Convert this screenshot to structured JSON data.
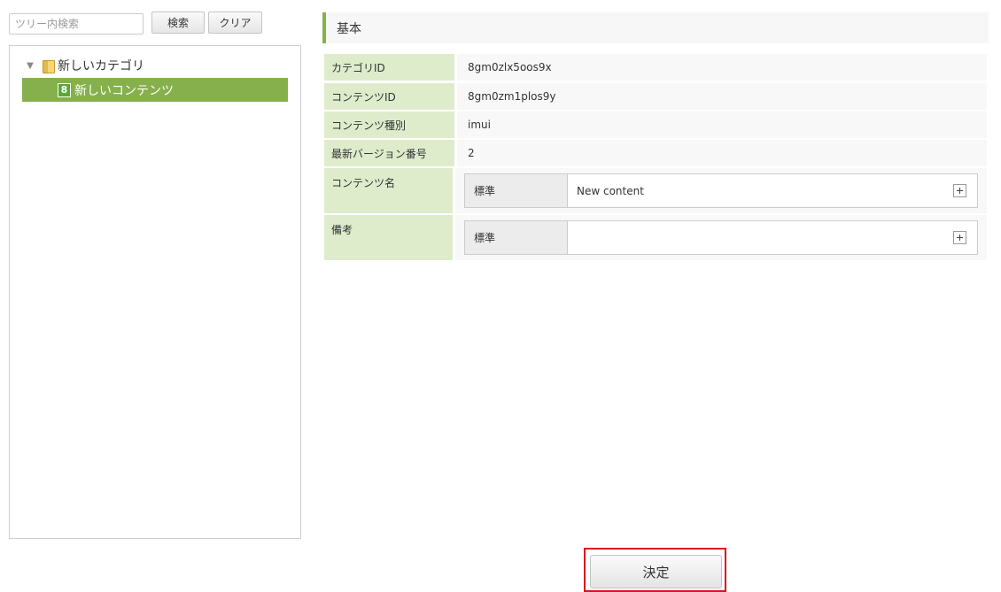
{
  "tree_search": {
    "placeholder": "ツリー内検索",
    "search_label": "検索",
    "clear_label": "クリア"
  },
  "tree": {
    "root": {
      "label": "新しいカテゴリ",
      "icon": "folder-icon"
    },
    "child": {
      "label": "新しいコンテンツ",
      "icon_glyph": "8"
    }
  },
  "section": {
    "title": "基本"
  },
  "details": {
    "category_id": {
      "label": "カテゴリID",
      "value": "8gm0zlx5oos9x"
    },
    "content_id": {
      "label": "コンテンツID",
      "value": "8gm0zm1plos9y"
    },
    "content_type": {
      "label": "コンテンツ種別",
      "value": "imui"
    },
    "version": {
      "label": "最新バージョン番号",
      "value": "2"
    },
    "content_name": {
      "label": "コンテンツ名",
      "locale": "標準",
      "value": "New content"
    },
    "remarks": {
      "label": "備考",
      "locale": "標準",
      "value": ""
    }
  },
  "footer": {
    "submit_label": "決定"
  },
  "colors": {
    "accent": "#86b04b",
    "label_bg": "#deeccb",
    "highlight": "#d9141c"
  }
}
